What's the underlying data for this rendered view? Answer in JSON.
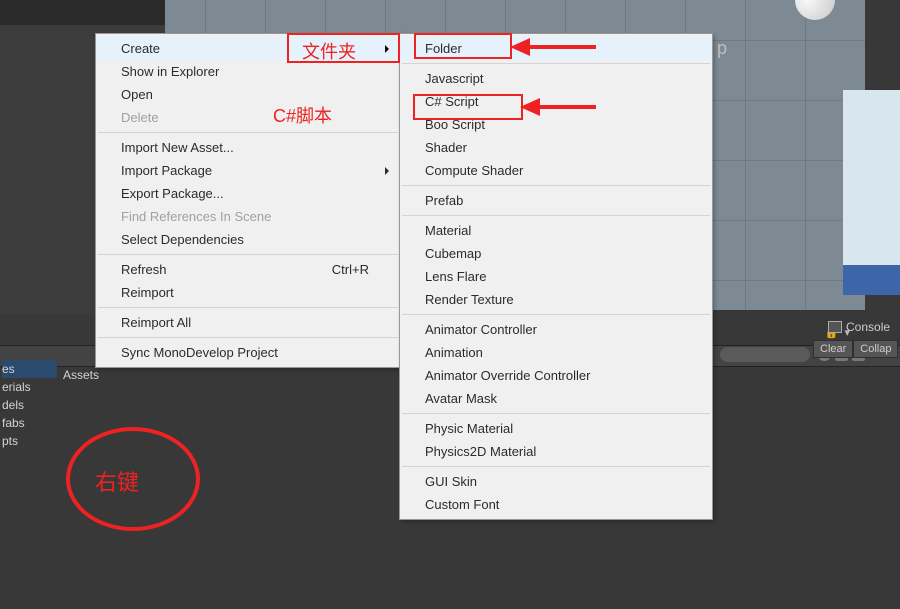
{
  "scene": {
    "letter_overlay": "p"
  },
  "project_panel": {
    "assets_label": "Assets",
    "sidebar": [
      "es",
      "erials",
      "dels",
      "fabs",
      "pts"
    ],
    "toolbar_icons": [
      "search",
      "star",
      "label"
    ]
  },
  "console_panel": {
    "title": "Console",
    "buttons": [
      "Clear",
      "Collap"
    ]
  },
  "context_menu": {
    "items": [
      {
        "label": "Create",
        "hover": true,
        "submenu": true
      },
      {
        "label": "Show in Explorer"
      },
      {
        "label": "Open"
      },
      {
        "label": "Delete",
        "disabled": true
      },
      {
        "sep": true
      },
      {
        "label": "Import New Asset..."
      },
      {
        "label": "Import Package",
        "submenu": true
      },
      {
        "label": "Export Package..."
      },
      {
        "label": "Find References In Scene",
        "disabled": true
      },
      {
        "label": "Select Dependencies"
      },
      {
        "sep": true
      },
      {
        "label": "Refresh",
        "shortcut": "Ctrl+R"
      },
      {
        "label": "Reimport"
      },
      {
        "sep": true
      },
      {
        "label": "Reimport All"
      },
      {
        "sep": true
      },
      {
        "label": "Sync MonoDevelop Project"
      }
    ]
  },
  "create_submenu": {
    "items": [
      {
        "label": "Folder",
        "hover": true
      },
      {
        "sep": true
      },
      {
        "label": "Javascript"
      },
      {
        "label": "C# Script"
      },
      {
        "label": "Boo Script"
      },
      {
        "label": "Shader"
      },
      {
        "label": "Compute Shader"
      },
      {
        "sep": true
      },
      {
        "label": "Prefab"
      },
      {
        "sep": true
      },
      {
        "label": "Material"
      },
      {
        "label": "Cubemap"
      },
      {
        "label": "Lens Flare"
      },
      {
        "label": "Render Texture"
      },
      {
        "sep": true
      },
      {
        "label": "Animator Controller"
      },
      {
        "label": "Animation"
      },
      {
        "label": "Animator Override Controller"
      },
      {
        "label": "Avatar Mask"
      },
      {
        "sep": true
      },
      {
        "label": "Physic Material"
      },
      {
        "label": "Physics2D Material"
      },
      {
        "sep": true
      },
      {
        "label": "GUI Skin"
      },
      {
        "label": "Custom Font"
      }
    ]
  },
  "annotations": {
    "folder_label": "文件夹",
    "csharp_label": "C#脚本",
    "rightclick_label": "右键"
  }
}
